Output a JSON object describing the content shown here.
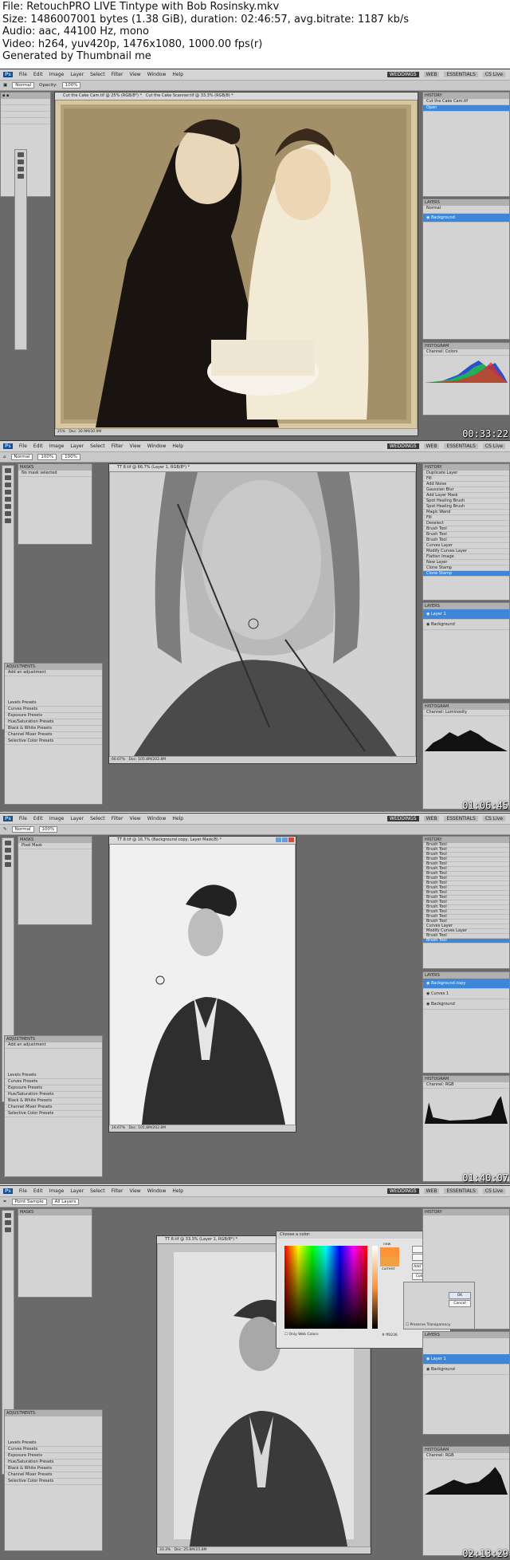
{
  "info": {
    "file": "File: RetouchPRO LIVE Tintype with Bob Rosinsky.mkv",
    "size": "Size: 1486007001 bytes (1.38 GiB), duration: 02:46:57, avg.bitrate: 1187 kb/s",
    "audio": "Audio: aac, 44100 Hz, mono",
    "video": "Video: h264, yuv420p, 1476x1080, 1000.00 fps(r)",
    "generator": "Generated by Thumbnail me"
  },
  "app": {
    "menu": [
      "File",
      "Edit",
      "Image",
      "Layer",
      "Select",
      "Filter",
      "View",
      "Window",
      "Help"
    ],
    "workspaces": [
      "WEDDINGS",
      "WEB",
      "ESSENTIALS"
    ],
    "cs_live": "CS Live"
  },
  "frames": [
    {
      "timestamp": "00:33:22",
      "tabs": [
        "Cut the Cake Cam.tif @ 25% (RGB/8*) *",
        "Cut the Cake Scanner.tif @ 33.3% (RGB/8) *"
      ],
      "status": "Doc: 30.9M/30.9M",
      "zoom": "25%",
      "history_title": "HISTORY",
      "history_items": [
        "Cut the Cake Cam.tif",
        "Open"
      ],
      "layers_title": "LAYERS",
      "layers": [
        "Background"
      ],
      "histogram_title": "HISTOGRAM",
      "channel": "Colors"
    },
    {
      "timestamp": "01:06:45",
      "tabs": [
        "TT 8.tif @ 66.7% (Layer 1, RGB/8*) *"
      ],
      "status": "Doc: 105.8M/202.8M",
      "zoom": "66.67%",
      "masks_title": "MASKS",
      "masks_text": "No mask selected",
      "history_items": [
        "Duplicate Layer",
        "Fill",
        "Add Noise",
        "Gaussian Blur",
        "Add Layer Mask",
        "Spot Healing Brush",
        "Spot Healing Brush",
        "Magic Wand",
        "Fill",
        "Deselect",
        "Brush Tool",
        "Brush Tool",
        "Brush Tool",
        "Curves Layer",
        "Modify Curves Layer",
        "Flatten Image",
        "New Layer",
        "Clone Stamp",
        "Clone Stamp"
      ],
      "layers": [
        "Layer 1",
        "Background"
      ],
      "adjustments_title": "ADJUSTMENTS",
      "adjustments_label": "Add an adjustment",
      "presets": [
        "Levels Presets",
        "Curves Presets",
        "Exposure Presets",
        "Hue/Saturation Presets",
        "Black & White Presets",
        "Channel Mixer Presets",
        "Selective Color Presets"
      ],
      "channel": "Luminosity"
    },
    {
      "timestamp": "01:40:07",
      "tabs": [
        "TT 8.tif @ 16.7% (Background copy, Layer Mask/8) *"
      ],
      "status": "Doc: 105.8M/202.8M",
      "zoom": "16.67%",
      "masks_text": "Pixel Mask",
      "history_items": [
        "Brush Tool",
        "Brush Tool",
        "Brush Tool",
        "Brush Tool",
        "Brush Tool",
        "Brush Tool",
        "Brush Tool",
        "Brush Tool",
        "Brush Tool",
        "Brush Tool",
        "Brush Tool",
        "Brush Tool",
        "Brush Tool",
        "Brush Tool",
        "Brush Tool",
        "Brush Tool",
        "Brush Tool",
        "Curves Layer",
        "Modify Curves Layer",
        "Brush Tool",
        "Brush Tool"
      ],
      "layers": [
        "Background copy",
        "Curves 1",
        "Background"
      ],
      "adjustments_label": "Add an adjustment",
      "presets": [
        "Levels Presets",
        "Curves Presets",
        "Exposure Presets",
        "Hue/Saturation Presets",
        "Black & White Presets",
        "Channel Mixer Presets",
        "Selective Color Presets"
      ],
      "channel": "RGB"
    },
    {
      "timestamp": "02:13:29",
      "tabs": [
        "TT 8.tif @ 33.3% (Layer 1, RGB/8*) *"
      ],
      "status": "Doc: 25.8M/25.8M",
      "zoom": "33.3%",
      "dialog_title": "Choose a color:",
      "dialog_buttons": [
        "OK",
        "Cancel",
        "Add To Swatches",
        "Color Libraries"
      ],
      "new_label": "new",
      "current_label": "current",
      "only_web": "Only Web Colors",
      "hex": "ff9236",
      "preserve": "Preserve Transparency",
      "layers": [
        "Layer 1",
        "Background"
      ],
      "presets": [
        "Levels Presets",
        "Curves Presets",
        "Exposure Presets",
        "Hue/Saturation Presets",
        "Black & White Presets",
        "Channel Mixer Presets",
        "Selective Color Presets"
      ],
      "channel": "RGB"
    }
  ]
}
